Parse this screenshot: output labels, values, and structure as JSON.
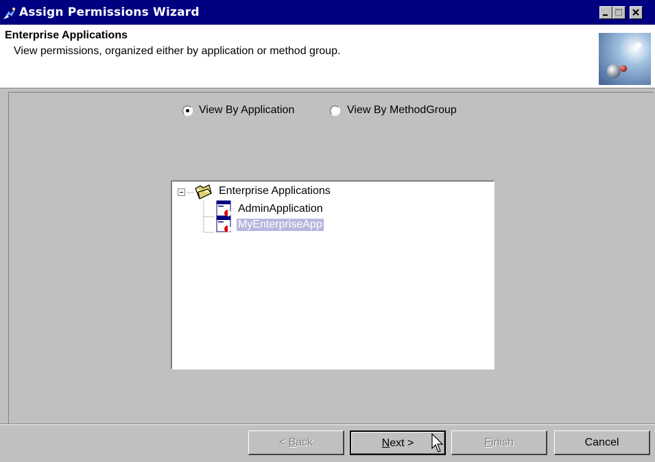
{
  "window": {
    "title": "Assign Permissions Wizard",
    "controls": [
      "minimize-icon",
      "maximize-icon",
      "close-icon"
    ]
  },
  "header": {
    "title": "Enterprise Applications",
    "description": "View permissions, organized either by application or method group."
  },
  "view_options": {
    "by_application": {
      "label": "View By Application",
      "selected": true
    },
    "by_method_group": {
      "label": "View By MethodGroup",
      "selected": false
    }
  },
  "tree": {
    "root": {
      "label": "Enterprise Applications",
      "expanded": true,
      "icon": "open-folder-icon"
    },
    "children": [
      {
        "label": "AdminApplication",
        "icon": "application-icon",
        "selected": false
      },
      {
        "label": "MyEnterpriseApp",
        "icon": "application-icon",
        "selected": true
      }
    ]
  },
  "buttons": {
    "back": {
      "prefix": "< ",
      "mnemonic": "B",
      "rest": "ack",
      "enabled": false
    },
    "next": {
      "mnemonic": "N",
      "rest": "ext >",
      "enabled": true
    },
    "finish": {
      "mnemonic": "F",
      "rest": "inish",
      "enabled": false
    },
    "cancel": {
      "label": "Cancel",
      "enabled": true
    }
  },
  "colors": {
    "title_bar": "#000080",
    "dialog_face": "#c0c0c0",
    "selection": "#b7b7de"
  }
}
